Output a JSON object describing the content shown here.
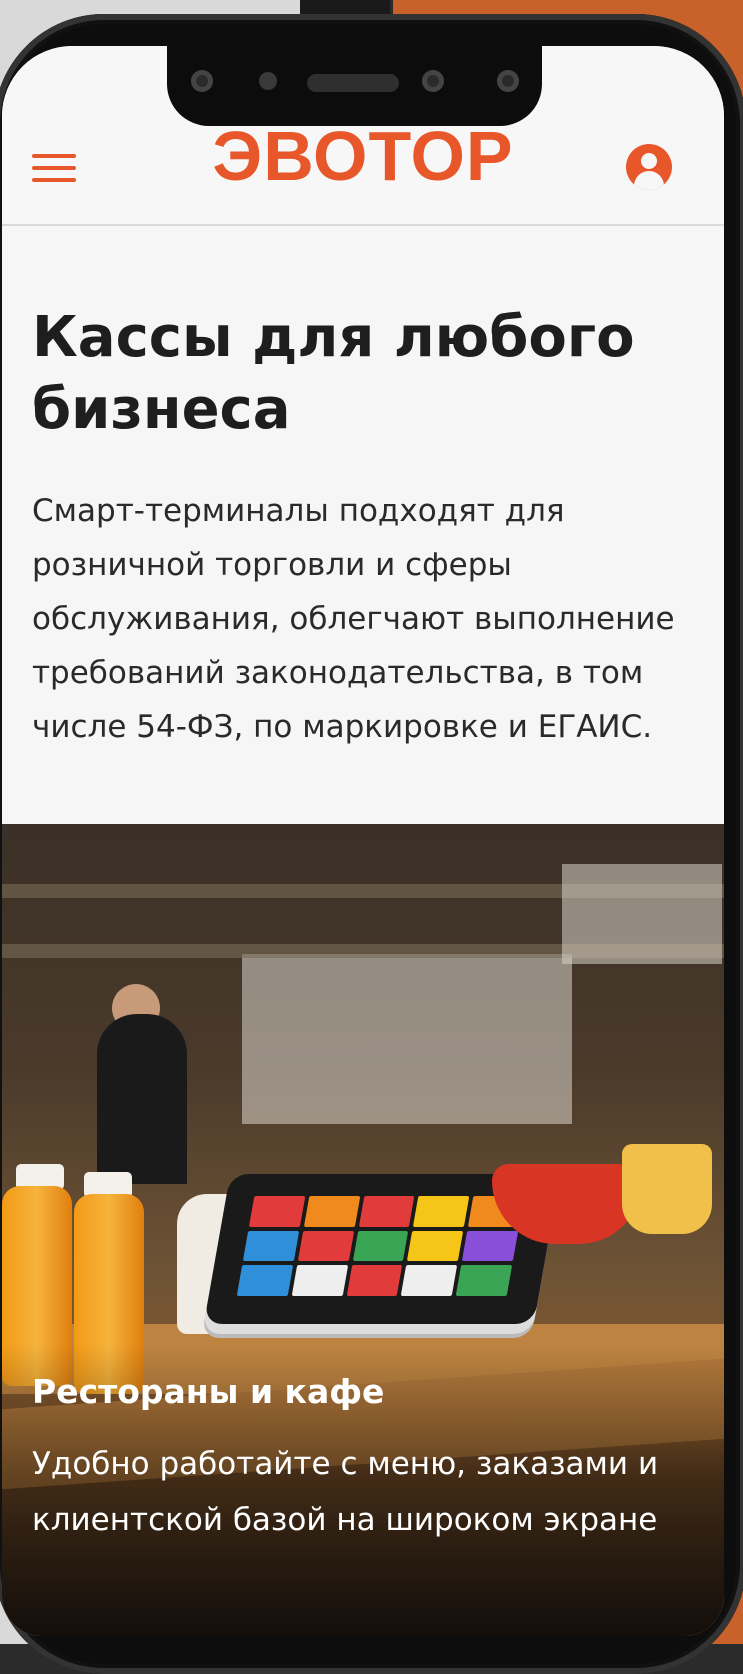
{
  "header": {
    "logo": "ЭВОТОР",
    "menu_icon": "hamburger-menu-icon",
    "user_icon": "user-account-icon"
  },
  "hero": {
    "title": "Кассы для любого бизнеса",
    "description": "Смарт-терминалы подходят для розничной торговли и сферы обслуживания, облегчают выполнение требований законодательства, в том числе 54-ФЗ, по маркировке и ЕГАИС."
  },
  "card": {
    "title": "Рестораны и кафе",
    "description": "Удобно работайте с меню, заказами и клиентской базой на широком экране"
  },
  "colors": {
    "accent": "#e8572a",
    "background": "#f6f6f6",
    "text": "#1e1e1e"
  }
}
